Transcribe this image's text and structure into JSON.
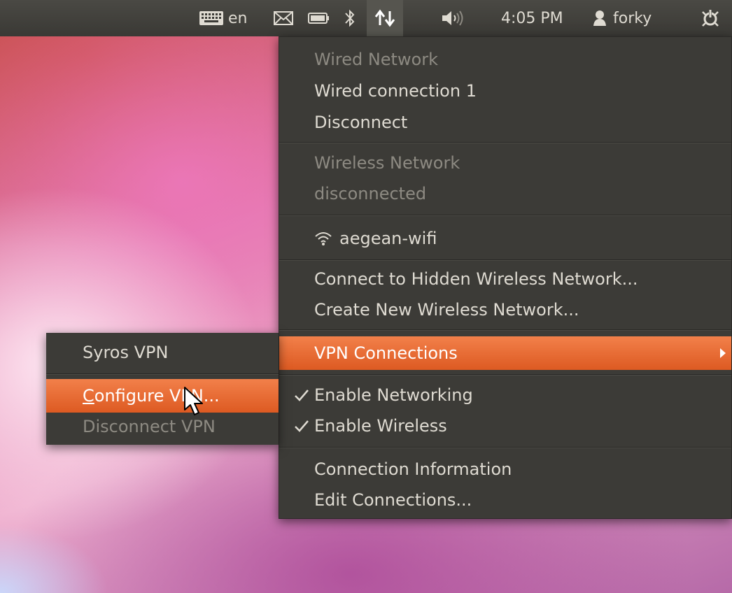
{
  "panel": {
    "keyboard_layout": "en",
    "clock": "4:05 PM",
    "user": "forky",
    "icons": [
      "keyboard-icon",
      "mail-icon",
      "battery-icon",
      "bluetooth-icon",
      "network-icon",
      "volume-icon",
      "user-icon",
      "power-icon"
    ]
  },
  "network_menu": {
    "wired_header": "Wired Network",
    "wired_connection": "Wired connection 1",
    "disconnect": "Disconnect",
    "wireless_header": "Wireless Network",
    "wireless_status": "disconnected",
    "wifi_network": "aegean-wifi",
    "connect_hidden": "Connect to Hidden Wireless Network...",
    "create_new": "Create New Wireless Network...",
    "vpn_connections": "VPN Connections",
    "enable_networking": "Enable Networking",
    "enable_wireless": "Enable Wireless",
    "connection_info": "Connection Information",
    "edit_connections": "Edit Connections..."
  },
  "vpn_submenu": {
    "syros_vpn": "Syros VPN",
    "configure_mnemonic": "C",
    "configure_rest": "onfigure VPN...",
    "disconnect_vpn": "Disconnect VPN"
  },
  "colors": {
    "panel_bg": "#3c3b37",
    "highlight": "#e8682e",
    "menu_text": "#dfdbd2",
    "dim_text": "#8d8a82"
  }
}
